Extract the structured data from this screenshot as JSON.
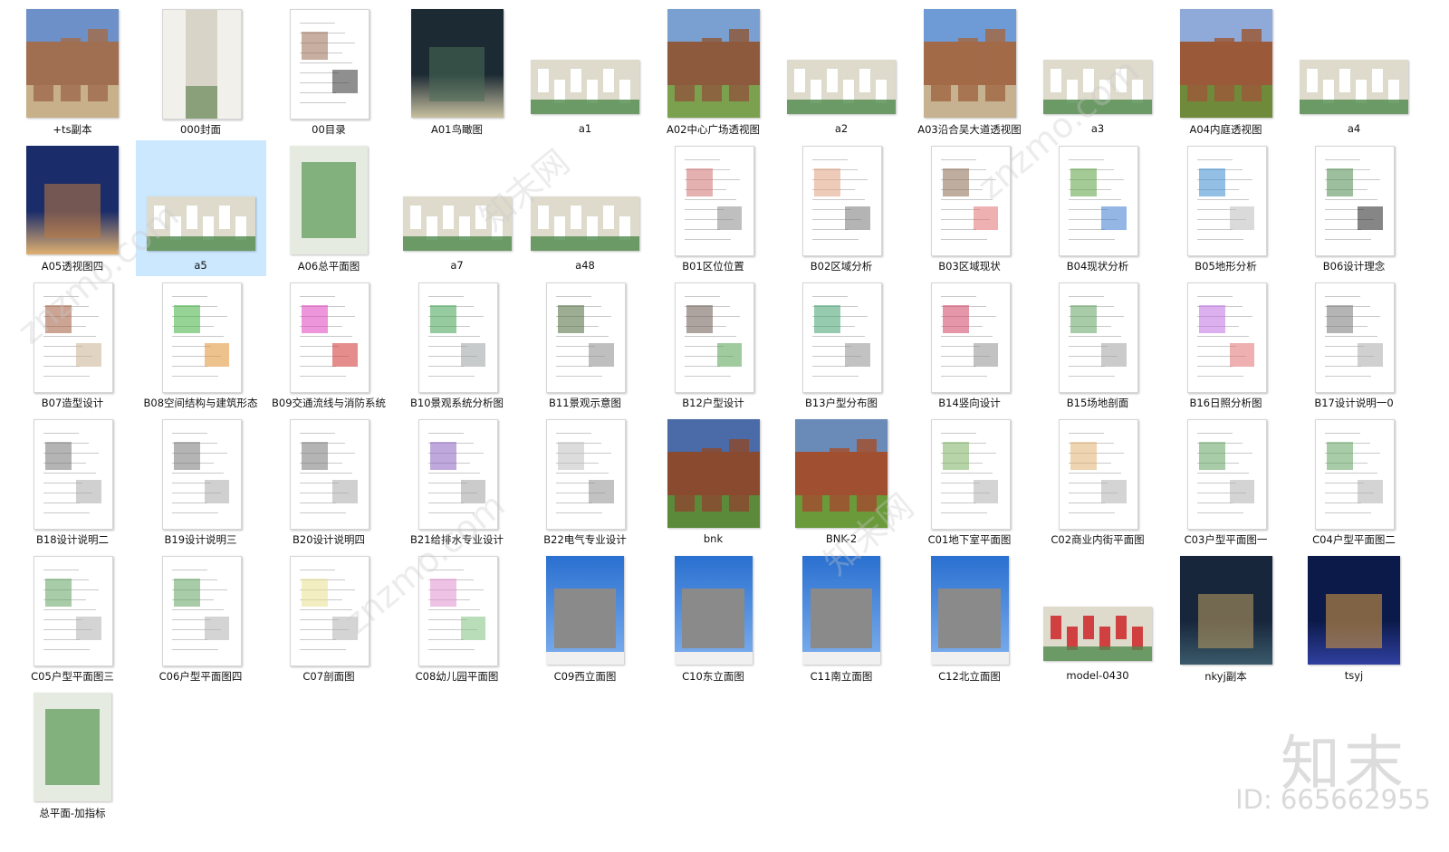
{
  "files": [
    {
      "label": "+ts副本",
      "kind": "photo",
      "colors": [
        "#6e90c8",
        "#a06e50",
        "#c8b08a"
      ]
    },
    {
      "label": "000封面",
      "kind": "cover",
      "colors": [
        "#d8d4c8",
        "#8aa07a",
        "#f2f0ea"
      ]
    },
    {
      "label": "00目录",
      "kind": "doc",
      "colors": [
        "#ffffff",
        "#9a6b52",
        "#333333"
      ]
    },
    {
      "label": "A01鸟瞰图",
      "kind": "dark",
      "colors": [
        "#1b2a33",
        "#4a6d58",
        "#c8c0a0"
      ]
    },
    {
      "label": "a1",
      "kind": "model",
      "colors": [
        "#dedbcc",
        "#4f8a4c",
        "#ffffff"
      ]
    },
    {
      "label": "A02中心广场透视图",
      "kind": "photo",
      "colors": [
        "#7aa0d2",
        "#8e5a3e",
        "#7ba04e"
      ]
    },
    {
      "label": "a2",
      "kind": "model",
      "colors": [
        "#dedbcc",
        "#4f8a4c",
        "#ffffff"
      ]
    },
    {
      "label": "A03沿合吴大道透视图",
      "kind": "photo",
      "colors": [
        "#6e9ad6",
        "#a26a48",
        "#c6b290"
      ]
    },
    {
      "label": "a3",
      "kind": "model",
      "colors": [
        "#dedbcc",
        "#4f8a4c",
        "#ffffff"
      ]
    },
    {
      "label": "A04内庭透视图",
      "kind": "photo",
      "colors": [
        "#8fa9d8",
        "#9a5a3a",
        "#6f8a3a"
      ]
    },
    {
      "label": "a4",
      "kind": "model",
      "colors": [
        "#dedbcc",
        "#4f8a4c",
        "#ffffff"
      ]
    },
    {
      "label": "A05透视图四",
      "kind": "dark",
      "colors": [
        "#1a2c6a",
        "#c07a40",
        "#e0b070"
      ]
    },
    {
      "label": "a5",
      "kind": "model",
      "colors": [
        "#dedbcc",
        "#4f8a4c",
        "#ffffff"
      ]
    },
    {
      "label": "A06总平面图",
      "kind": "plan",
      "colors": [
        "#e6ebe2",
        "#3f8a3c",
        "#ffffff"
      ]
    },
    {
      "label": "a7",
      "kind": "model",
      "colors": [
        "#dedbcc",
        "#4f8a4c",
        "#ffffff"
      ]
    },
    {
      "label": "a48",
      "kind": "model",
      "colors": [
        "#dedbcc",
        "#4f8a4c",
        "#ffffff"
      ]
    },
    {
      "label": "B01区位位置",
      "kind": "doc",
      "colors": [
        "#ffffff",
        "#d07070",
        "#8a8a8a"
      ]
    },
    {
      "label": "B02区域分析",
      "kind": "doc",
      "colors": [
        "#ffffff",
        "#e0a080",
        "#777777"
      ]
    },
    {
      "label": "B03区域现状",
      "kind": "doc",
      "colors": [
        "#ffffff",
        "#8a6a50",
        "#e07070"
      ]
    },
    {
      "label": "B04现状分析",
      "kind": "doc",
      "colors": [
        "#ffffff",
        "#5aa040",
        "#3a7ad0"
      ]
    },
    {
      "label": "B05地形分析",
      "kind": "doc",
      "colors": [
        "#ffffff",
        "#3a8ad0",
        "#bbbbbb"
      ]
    },
    {
      "label": "B06设计理念",
      "kind": "doc",
      "colors": [
        "#ffffff",
        "#4f8a4c",
        "#222222"
      ]
    },
    {
      "label": "B07造型设计",
      "kind": "doc",
      "colors": [
        "#ffffff",
        "#a05a3a",
        "#c8b090"
      ]
    },
    {
      "label": "B08空间结构与建筑形态",
      "kind": "doc",
      "colors": [
        "#ffffff",
        "#40b040",
        "#e09030"
      ]
    },
    {
      "label": "B09交通流线与消防系统",
      "kind": "doc",
      "colors": [
        "#ffffff",
        "#e040c0",
        "#d03030"
      ]
    },
    {
      "label": "B10景观系统分析图",
      "kind": "doc",
      "colors": [
        "#ffffff",
        "#40a050",
        "#9aa0a0"
      ]
    },
    {
      "label": "B11景观示意图",
      "kind": "doc",
      "colors": [
        "#ffffff",
        "#4a6a3a",
        "#8a8a8a"
      ]
    },
    {
      "label": "B12户型设计",
      "kind": "doc",
      "colors": [
        "#ffffff",
        "#6a5a50",
        "#50a050"
      ]
    },
    {
      "label": "B13户型分布图",
      "kind": "doc",
      "colors": [
        "#ffffff",
        "#40a070",
        "#909090"
      ]
    },
    {
      "label": "B14竖向设计",
      "kind": "doc",
      "colors": [
        "#ffffff",
        "#d04060",
        "#909090"
      ]
    },
    {
      "label": "B15场地剖面",
      "kind": "doc",
      "colors": [
        "#ffffff",
        "#60a060",
        "#a0a0a0"
      ]
    },
    {
      "label": "B16日照分析图",
      "kind": "doc",
      "colors": [
        "#ffffff",
        "#c070e0",
        "#e07070"
      ]
    },
    {
      "label": "B17设计说明一0",
      "kind": "doc",
      "colors": [
        "#ffffff",
        "#777777",
        "#aaaaaa"
      ]
    },
    {
      "label": "B18设计说明二",
      "kind": "doc",
      "colors": [
        "#ffffff",
        "#777777",
        "#aaaaaa"
      ]
    },
    {
      "label": "B19设计说明三",
      "kind": "doc",
      "colors": [
        "#ffffff",
        "#777777",
        "#aaaaaa"
      ]
    },
    {
      "label": "B20设计说明四",
      "kind": "doc",
      "colors": [
        "#ffffff",
        "#777777",
        "#aaaaaa"
      ]
    },
    {
      "label": "B21给排水专业设计",
      "kind": "doc",
      "colors": [
        "#ffffff",
        "#8a60c0",
        "#a0a0a0"
      ]
    },
    {
      "label": "B22电气专业设计",
      "kind": "doc",
      "colors": [
        "#ffffff",
        "#c0c0c0",
        "#909090"
      ]
    },
    {
      "label": "bnk",
      "kind": "photo",
      "colors": [
        "#4a6aa8",
        "#8a4a30",
        "#5a8a3a"
      ]
    },
    {
      "label": "BNK-2",
      "kind": "photo",
      "colors": [
        "#6a8ab8",
        "#a05030",
        "#6a9a3a"
      ]
    },
    {
      "label": "C01地下室平面图",
      "kind": "doc",
      "colors": [
        "#ffffff",
        "#7ab060",
        "#b0b0b0"
      ]
    },
    {
      "label": "C02商业内街平面图",
      "kind": "doc",
      "colors": [
        "#ffffff",
        "#e0b070",
        "#b0b0b0"
      ]
    },
    {
      "label": "C03户型平面图一",
      "kind": "doc",
      "colors": [
        "#ffffff",
        "#60a060",
        "#b0b0b0"
      ]
    },
    {
      "label": "C04户型平面图二",
      "kind": "doc",
      "colors": [
        "#ffffff",
        "#60a060",
        "#b0b0b0"
      ]
    },
    {
      "label": "C05户型平面图三",
      "kind": "doc",
      "colors": [
        "#ffffff",
        "#60a060",
        "#b0b0b0"
      ]
    },
    {
      "label": "C06户型平面图四",
      "kind": "doc",
      "colors": [
        "#ffffff",
        "#60a060",
        "#b0b0b0"
      ]
    },
    {
      "label": "C07剖面图",
      "kind": "doc",
      "colors": [
        "#ffffff",
        "#e8e090",
        "#b0b0b0"
      ]
    },
    {
      "label": "C08幼儿园平面图",
      "kind": "doc",
      "colors": [
        "#ffffff",
        "#e090d0",
        "#80c080"
      ]
    },
    {
      "label": "C09西立面图",
      "kind": "elev",
      "colors": [
        "#2a70d0",
        "#8a8a8a",
        "#f0f0f0"
      ]
    },
    {
      "label": "C10东立面图",
      "kind": "elev",
      "colors": [
        "#2a70d0",
        "#8a8a8a",
        "#f0f0f0"
      ]
    },
    {
      "label": "C11南立面图",
      "kind": "elev",
      "colors": [
        "#2a70d0",
        "#8a8a8a",
        "#f0f0f0"
      ]
    },
    {
      "label": "C12北立面图",
      "kind": "elev",
      "colors": [
        "#2a70d0",
        "#8a8a8a",
        "#f0f0f0"
      ]
    },
    {
      "label": "model-0430",
      "kind": "model",
      "colors": [
        "#dedbcc",
        "#4f8a4c",
        "#d04040"
      ]
    },
    {
      "label": "nkyj副本",
      "kind": "dark",
      "colors": [
        "#18263c",
        "#c0a060",
        "#3a5a6a"
      ]
    },
    {
      "label": "tsyj",
      "kind": "dark",
      "colors": [
        "#0c1a4a",
        "#e0a040",
        "#3040a0"
      ]
    },
    {
      "label": "总平面-加指标",
      "kind": "plan",
      "colors": [
        "#e6ebe2",
        "#3f8a3c",
        "#ffffff"
      ]
    }
  ],
  "watermark": {
    "brand": "知末",
    "id": "ID: 665662955",
    "diag_text": "znzmo.com",
    "diag_text_cn": "知末网"
  }
}
